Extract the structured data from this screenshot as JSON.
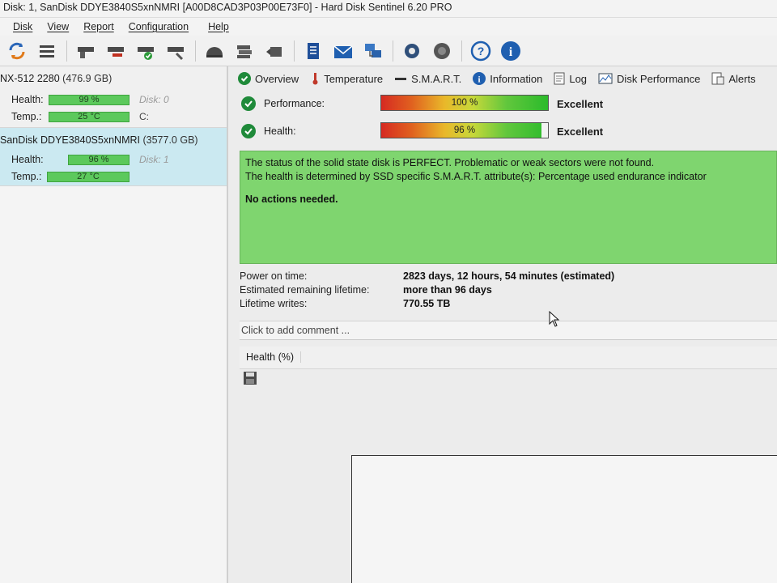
{
  "window": {
    "title": "Disk: 1, SanDisk DDYE3840S5xnNMRI [A00D8CAD3P03P00E73F0]  -  Hard Disk Sentinel 6.20 PRO"
  },
  "menu": [
    "Disk",
    "View",
    "Report",
    "Configuration",
    "Help"
  ],
  "disks": [
    {
      "name": "NX-512 2280",
      "size": "(476.9 GB)",
      "health_label": "Health:",
      "health_value": "99 %",
      "temp_label": "Temp.:",
      "temp_value": "25 °C",
      "disk_index": "Disk: 0",
      "drive_letter": "C:",
      "health_pct": 99
    },
    {
      "name": "SanDisk DDYE3840S5xnNMRI",
      "size": "(3577.0 GB)",
      "health_label": "Health:",
      "health_value": "96 %",
      "temp_label": "Temp.:",
      "temp_value": "27 °C",
      "disk_index": "Disk: 1",
      "health_pct": 96
    }
  ],
  "tabs": [
    "Overview",
    "Temperature",
    "S.M.A.R.T.",
    "Information",
    "Log",
    "Disk Performance",
    "Alerts"
  ],
  "performance": {
    "label": "Performance:",
    "value": "100 %",
    "pct": 100,
    "rating": "Excellent"
  },
  "health": {
    "label": "Health:",
    "value": "96 %",
    "pct": 96,
    "rating": "Excellent"
  },
  "status": {
    "line1": "The status of the solid state disk is PERFECT. Problematic or weak sectors were not found.",
    "line2": "The health is determined by SSD specific S.M.A.R.T. attribute(s):  Percentage used endurance indicator",
    "actions": "No actions needed."
  },
  "info": [
    {
      "key": "Power on time:",
      "value": "2823 days, 12 hours, 54 minutes (estimated)"
    },
    {
      "key": "Estimated remaining lifetime:",
      "value": "more than 96 days"
    },
    {
      "key": "Lifetime writes:",
      "value": "770.55 TB"
    }
  ],
  "comment_placeholder": "Click to add comment ...",
  "chart_tab": "Health (%)",
  "colors": {
    "status_green": "#7fd56f",
    "selected_disk": "#cbe9f1",
    "check_green": "#1f8a3a"
  },
  "toolbar_icons": [
    "refresh-icon",
    "menu-icon",
    "disk-icon",
    "disk-remove-icon",
    "disk-check-icon",
    "disk-tools-icon",
    "hdd-dome-icon",
    "disk-stack-icon",
    "disk-arrow-icon",
    "report-icon",
    "mail-icon",
    "network-icon",
    "settings-gear-icon",
    "alert-sound-icon",
    "help-icon",
    "info-icon"
  ]
}
